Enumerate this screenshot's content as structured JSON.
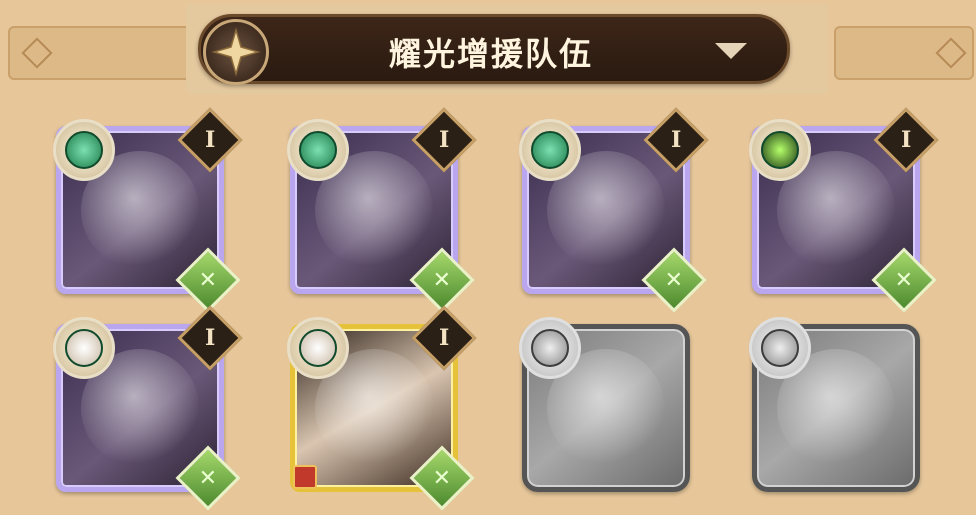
{
  "header": {
    "title": "耀光增援队伍",
    "dropdown_icon": "chevron-down-icon",
    "emblem_icon": "star-compass-icon"
  },
  "colors": {
    "background": "#e7c79a",
    "title_bar": "#2a1a10",
    "card_border_purple": "#b9a6ee",
    "card_border_gold": "#e5c23a",
    "class_badge_green": "#6fb043"
  },
  "heroes": [
    {
      "slot": 1,
      "faction": "wilder",
      "tier": "I",
      "class": "ranger",
      "frame": "purple",
      "locked": false
    },
    {
      "slot": 2,
      "faction": "wilder",
      "tier": "I",
      "class": "ranger",
      "frame": "purple",
      "locked": false
    },
    {
      "slot": 3,
      "faction": "wilder",
      "tier": "I",
      "class": "ranger",
      "frame": "purple",
      "locked": false
    },
    {
      "slot": 4,
      "faction": "graveborn",
      "tier": "I",
      "class": "ranger",
      "frame": "purple",
      "locked": false
    },
    {
      "slot": 5,
      "faction": "lightbearer",
      "tier": "I",
      "class": "ranger",
      "frame": "purple",
      "locked": false
    },
    {
      "slot": 6,
      "faction": "celestial",
      "tier": "I",
      "class": "ranger",
      "frame": "gold",
      "locked": false
    },
    {
      "slot": 7,
      "faction": "lightbearer",
      "tier": "",
      "class": "",
      "frame": "grey",
      "locked": true
    },
    {
      "slot": 8,
      "faction": "lightbearer",
      "tier": "",
      "class": "",
      "frame": "grey",
      "locked": true
    }
  ]
}
